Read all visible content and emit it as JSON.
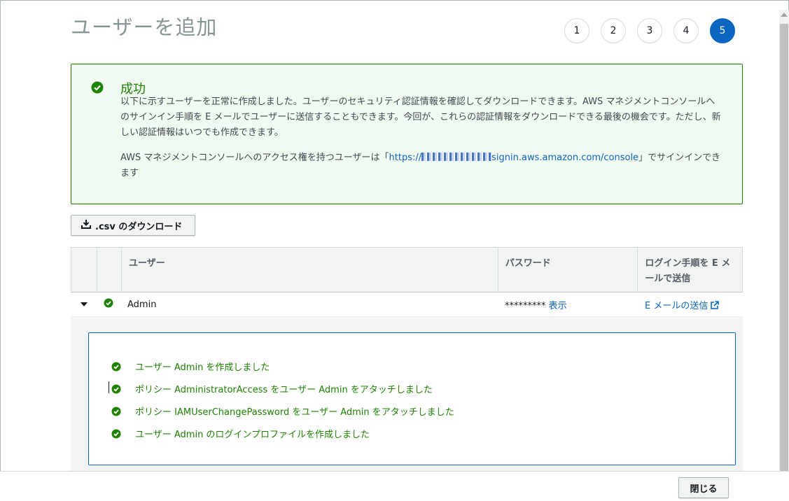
{
  "page": {
    "title": "ユーザーを追加"
  },
  "steps": [
    "1",
    "2",
    "3",
    "4",
    "5"
  ],
  "active_step": "5",
  "alert": {
    "title": "成功",
    "message": "以下に示すユーザーを正常に作成しました。ユーザーのセキュリティ認証情報を確認してダウンロードできます。AWS マネジメントコンソールへのサインイン手順を E メールでユーザーに送信することもできます。今回が、これらの認証情報をダウンロードできる最後の機会です。ただし、新しい認証情報はいつでも作成できます。",
    "console_prefix": "AWS マネジメントコンソールへのアクセス権を持つユーザーは「",
    "console_url_start": "https://",
    "console_url_end": "signin.aws.amazon.com/console",
    "console_suffix": "」でサインインできます"
  },
  "download_button": {
    "label": ".csv のダウンロード"
  },
  "table": {
    "headers": {
      "user": "ユーザー",
      "password": "パスワード",
      "email": "ログイン手順を E メールで送信"
    },
    "rows": [
      {
        "user": "Admin",
        "password_mask": "*********",
        "show_label": "表示",
        "email_link": "E メールの送信"
      }
    ]
  },
  "details": {
    "items": [
      "ユーザー Admin を作成しました",
      "ポリシー AdministratorAccess をユーザー Admin をアタッチしました",
      "ポリシー IAMUserChangePassword をユーザー Admin をアタッチしました",
      "ユーザー Admin のログインプロファイルを作成しました"
    ]
  },
  "footer": {
    "close_label": "閉じる"
  },
  "colors": {
    "success": "#1d8102",
    "link": "#0b66c2",
    "title": "#879596"
  }
}
